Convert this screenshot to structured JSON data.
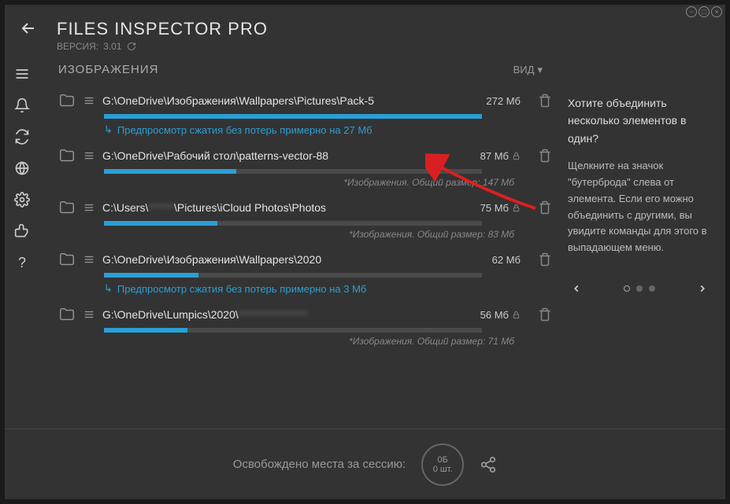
{
  "app": {
    "title": "FILES INSPECTOR PRO",
    "version_prefix": "ВЕРСИЯ:",
    "version": "3.01"
  },
  "section": {
    "title": "ИЗОБРАЖЕНИЯ",
    "view_label": "ВИД"
  },
  "items": [
    {
      "path": "G:\\OneDrive\\Изображения\\Wallpapers\\Pictures\\Pack-5",
      "size": "272 Мб",
      "bar_pct": 100,
      "preview": "Предпросмотр сжатия без потерь примерно на 27 Мб",
      "locked": false
    },
    {
      "path": "G:\\OneDrive\\Рабочий стол\\patterns-vector-88",
      "size": "87 Мб",
      "bar_pct": 35,
      "sub": "*Изображения. Общий размер: 147 Мб",
      "locked": true
    },
    {
      "path_prefix": "C:\\Users\\",
      "path_blur": "******",
      "path_suffix": "\\Pictures\\iCloud Photos\\Photos",
      "size": "75 Мб",
      "bar_pct": 30,
      "sub": "*Изображения. Общий размер: 83 Мб",
      "locked": true
    },
    {
      "path": "G:\\OneDrive\\Изображения\\Wallpapers\\2020",
      "size": "62 Мб",
      "bar_pct": 25,
      "preview": "Предпросмотр сжатия без потерь примерно на 3 Мб",
      "locked": false
    },
    {
      "path_prefix": "G:\\OneDrive\\Lumpics\\2020\\",
      "path_blur": "****************",
      "size": "56 Мб",
      "bar_pct": 22,
      "sub": "*Изображения. Общий размер: 71 Мб",
      "locked": true
    }
  ],
  "tip": {
    "title": "Хотите объединить несколько элементов в один?",
    "body": "Щелкните на значок \"бутерброда\" слева от элемента. Если его можно объединить с другими, вы увидите команды для этого в выпадающем меню."
  },
  "status": {
    "label": "Освобождено места за сессию:",
    "freed_size": "0Б",
    "freed_count": "0 шт."
  }
}
